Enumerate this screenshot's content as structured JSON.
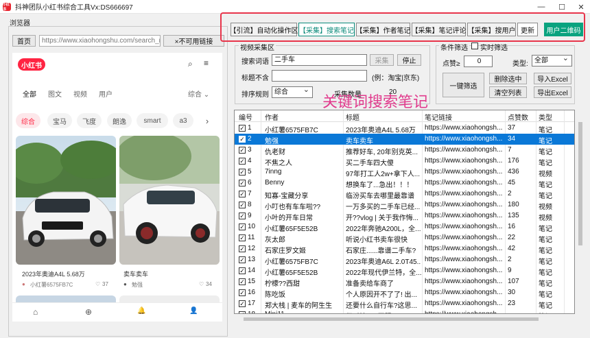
{
  "window": {
    "title": "抖神团队小红书综合工具Vx:DS666697",
    "app_icon_text": "小红书",
    "minimize": "—",
    "maximize": "☐",
    "close": "✕"
  },
  "browser": {
    "label": "浏览器",
    "home_button": "首页",
    "address": "https://www.xiaohongshu.com/search_re",
    "copy_link_button": "×不可用链接",
    "logo": "小红书",
    "tabs": [
      "全部",
      "图文",
      "视频",
      "用户",
      "综合 ⌄"
    ],
    "chips": [
      "综合",
      "宝马",
      "飞度",
      "朗逸",
      "smart",
      "a3",
      "›"
    ],
    "cards": [
      {
        "title": "2023年奥迪A4L 5.68万",
        "author": "小红薯6575FB7C",
        "likes": "37"
      },
      {
        "title": "卖车卖车",
        "author": "勉强",
        "likes": "34"
      }
    ],
    "bottom_nav": [
      "⌂",
      "⊕",
      "🔔",
      "👤"
    ]
  },
  "toolbar": {
    "tabs": [
      "【引流】自动化操作区",
      "【采集】搜索笔记",
      "【采集】作者笔记",
      "【采集】笔记评论",
      "【采集】搜用户",
      "更新",
      "用户二维码"
    ],
    "active_tab": "【采集】搜索笔记"
  },
  "collect": {
    "group_label": "视频采集区",
    "keyword_label": "搜索词语",
    "keyword_value": "二手车",
    "collect_button": "采集",
    "stop_button": "停止",
    "title_exclude_label": "标题不含",
    "title_exclude_value": "",
    "title_exclude_hint": "(例：淘宝|京东)",
    "sort_label": "排序规则",
    "sort_value": "综合",
    "count_label": "采集数量",
    "count_value": "20"
  },
  "filter": {
    "group_label": "条件筛选",
    "realtime_label": "实时筛选",
    "likes_label": "点赞≥",
    "likes_value": "0",
    "type_label": "类型:",
    "type_value": "全部",
    "one_key_filter": "一键筛选",
    "delete_selected": "删除选中",
    "import_excel": "导入Excel",
    "clear_list": "清空列表",
    "export_excel": "导出Excel"
  },
  "overlay_caption": "关键词搜索笔记",
  "table": {
    "columns": [
      "编号",
      "作者",
      "标题",
      "笔记链接",
      "点赞数",
      "类型"
    ],
    "rows": [
      {
        "no": "1",
        "author": "小红薯6575FB7C",
        "title": "2023年奥迪A4L 5.68万",
        "link": "https://www.xiaohongsh...",
        "likes": "37",
        "type": "笔记",
        "checked": true,
        "selected": false
      },
      {
        "no": "2",
        "author": "勉强",
        "title": "卖车卖车",
        "link": "https://www.xiaohongsh...",
        "likes": "34",
        "type": "笔记",
        "checked": true,
        "selected": true
      },
      {
        "no": "3",
        "author": "仇老财",
        "title": "推荐好车, 20年别克英...",
        "link": "https://www.xiaohongsh...",
        "likes": "7",
        "type": "笔记",
        "checked": true,
        "selected": false
      },
      {
        "no": "4",
        "author": "不焦之人",
        "title": "买二手车四大傻",
        "link": "https://www.xiaohongsh...",
        "likes": "176",
        "type": "笔记",
        "checked": true,
        "selected": false
      },
      {
        "no": "5",
        "author": "7inng",
        "title": "97年打工人2w+拿下人...",
        "link": "https://www.xiaohongsh...",
        "likes": "436",
        "type": "视频",
        "checked": true,
        "selected": false
      },
      {
        "no": "6",
        "author": "Benny",
        "title": "想换车了...急出！！！",
        "link": "https://www.xiaohongsh...",
        "likes": "45",
        "type": "笔记",
        "checked": true,
        "selected": false
      },
      {
        "no": "7",
        "author": "知寡-宝藏分享",
        "title": "临汾买车去哪里最靠谱",
        "link": "https://www.xiaohongsh...",
        "likes": "2",
        "type": "笔记",
        "checked": true,
        "selected": false
      },
      {
        "no": "8",
        "author": "小叮也有车车啦??",
        "title": "一万多买的二手车已经...",
        "link": "https://www.xiaohongsh...",
        "likes": "180",
        "type": "视频",
        "checked": true,
        "selected": false
      },
      {
        "no": "9",
        "author": "小叶的开车日常",
        "title": "开??vlog | 关于我作悔...",
        "link": "https://www.xiaohongsh...",
        "likes": "135",
        "type": "视频",
        "checked": true,
        "selected": false
      },
      {
        "no": "10",
        "author": "小红薯65F5E52B",
        "title": "2022年奔驰A200L，全...",
        "link": "https://www.xiaohongsh...",
        "likes": "16",
        "type": "笔记",
        "checked": true,
        "selected": false
      },
      {
        "no": "11",
        "author": "灰太郎",
        "title": "听说小红书卖车很快",
        "link": "https://www.xiaohongsh...",
        "likes": "22",
        "type": "笔记",
        "checked": true,
        "selected": false
      },
      {
        "no": "12",
        "author": "石家庄罗文姬",
        "title": "石家庄......靠谱二手车?",
        "link": "https://www.xiaohongsh...",
        "likes": "42",
        "type": "笔记",
        "checked": true,
        "selected": false
      },
      {
        "no": "13",
        "author": "小红薯6575FB7C",
        "title": "2023年奥迪A6L 2.0T45...",
        "link": "https://www.xiaohongsh...",
        "likes": "2",
        "type": "笔记",
        "checked": true,
        "selected": false
      },
      {
        "no": "14",
        "author": "小红薯65F5E52B",
        "title": "2022年现代伊兰特，全...",
        "link": "https://www.xiaohongsh...",
        "likes": "9",
        "type": "笔记",
        "checked": true,
        "selected": false
      },
      {
        "no": "15",
        "author": "柠檬??西甜",
        "title": "准备卖给车商了",
        "link": "https://www.xiaohongsh...",
        "likes": "107",
        "type": "笔记",
        "checked": true,
        "selected": false
      },
      {
        "no": "16",
        "author": "陈吃饭",
        "title": "个人原因开不了了! 出...",
        "link": "https://www.xiaohongsh...",
        "likes": "30",
        "type": "笔记",
        "checked": true,
        "selected": false
      },
      {
        "no": "17",
        "author": "郑大栈 | 麦车的阿生生",
        "title": "还要什么自行车?这思...",
        "link": "https://www.xiaohongsh...",
        "likes": "23",
        "type": "笔记",
        "checked": true,
        "selected": false
      },
      {
        "no": "18",
        "author": "Mini11",
        "title": "保时捷718开服了",
        "link": "https://www.xiaohongsh...",
        "likes": "",
        "type": "笔记",
        "checked": true,
        "selected": false
      }
    ]
  },
  "colors": {
    "accent_red": "#e8344a",
    "selection_blue": "#0a78d7",
    "caption_pink": "#e13b8d",
    "brand_red": "#ff2442",
    "qr_green": "#0aa37f"
  }
}
